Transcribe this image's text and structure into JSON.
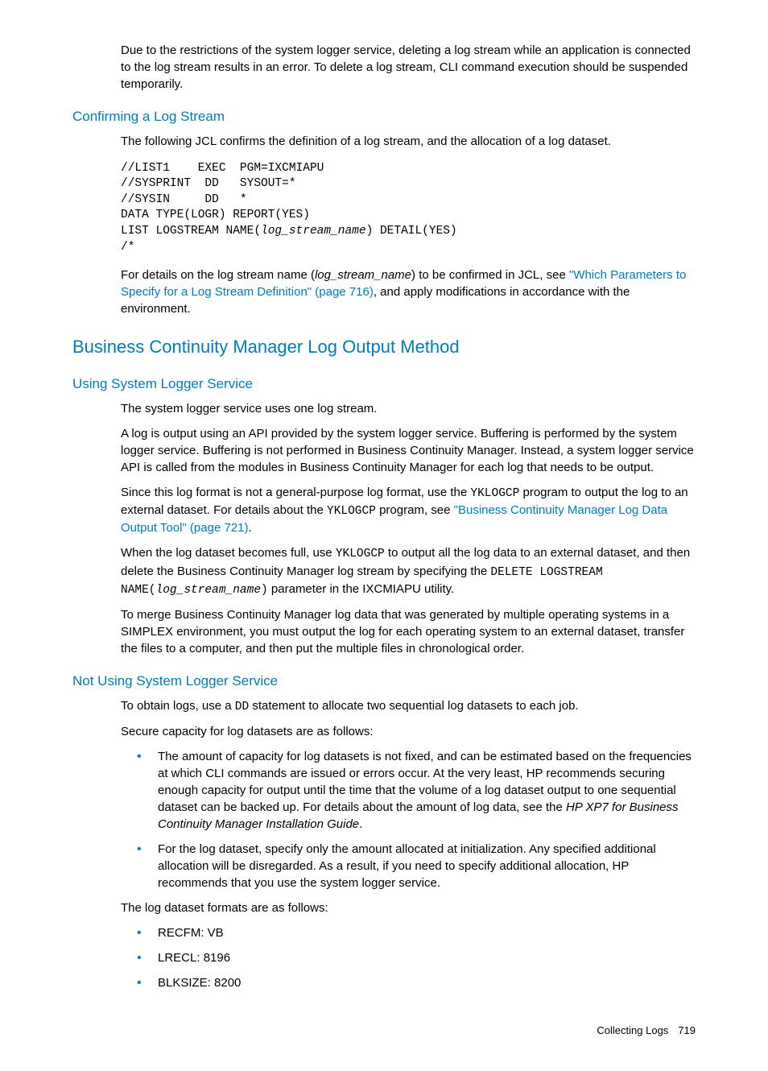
{
  "intro": {
    "p1": "Due to the restrictions of the system logger service, deleting a log stream while an application is connected to the log stream results in an error. To delete a log stream, CLI command execution should be suspended temporarily."
  },
  "confirming": {
    "heading": "Confirming a Log Stream",
    "p1": "The following JCL confirms the definition of a log stream, and the allocation of a log dataset.",
    "code_l1": "//LIST1    EXEC  PGM=IXCMIAPU",
    "code_l2": "//SYSPRINT  DD   SYSOUT=*",
    "code_l3": "//SYSIN     DD   *",
    "code_l4": "DATA TYPE(LOGR) REPORT(YES)",
    "code_l5a": "LIST LOGSTREAM NAME(",
    "code_l5b": "log_stream_name",
    "code_l5c": ") DETAIL(YES)",
    "code_l6": "/*",
    "p2a": "For details on the log stream name (",
    "p2b": "log_stream_name",
    "p2c": ") to be confirmed in JCL, see ",
    "p2link": "\"Which Parameters to Specify for a Log Stream Definition\" (page 716)",
    "p2d": ", and apply modifications in accordance with the environment."
  },
  "bcm": {
    "heading": "Business Continuity Manager Log Output Method"
  },
  "using": {
    "heading": "Using System Logger Service",
    "p1": "The system logger service uses one log stream.",
    "p2": "A log is output using an API provided by the system logger service. Buffering is performed by the system logger service. Buffering is not performed in Business Continuity Manager. Instead, a system logger service API is called from the modules in Business Continuity Manager for each log that needs to be output.",
    "p3a": "Since this log format is not a general-purpose log format, use the ",
    "p3m1": "YKLOGCP",
    "p3b": " program to output the log to an external dataset. For details about the ",
    "p3m2": "YKLOGCP",
    "p3c": " program, see ",
    "p3link": "\"Business Continuity Manager Log Data Output Tool\" (page 721)",
    "p3d": ".",
    "p4a": "When the log dataset becomes full, use ",
    "p4m1": "YKLOGCP",
    "p4b": " to output all the log data to an external dataset, and then delete the Business Continuity Manager log stream by specifying the ",
    "p4m2": "DELETE LOGSTREAM NAME(",
    "p4m3": "log_stream_name",
    "p4m4": ")",
    "p4c": " parameter in the IXCMIAPU utility.",
    "p5": "To merge Business Continuity Manager log data that was generated by multiple operating systems in a SIMPLEX environment, you must output the log for each operating system to an external dataset, transfer the files to a computer, and then put the multiple files in chronological order."
  },
  "notusing": {
    "heading": "Not Using System Logger Service",
    "p1a": "To obtain logs, use a ",
    "p1m": "DD",
    "p1b": " statement to allocate two sequential log datasets to each job.",
    "p2": "Secure capacity for log datasets are as follows:",
    "b1a": "The amount of capacity for log datasets is not fixed, and can be estimated based on the frequencies at which CLI commands are issued or errors occur. At the very least, HP recommends securing enough capacity for output until the time that the volume of a log dataset output to one sequential dataset can be backed up. For details about the amount of log data, see the ",
    "b1i": "HP XP7 for Business Continuity Manager Installation Guide",
    "b1b": ".",
    "b2": "For the log dataset, specify only the amount allocated at initialization. Any specified additional allocation will be disregarded. As a result, if you need to specify additional allocation, HP recommends that you use the system logger service.",
    "p3": "The log dataset formats are as follows:",
    "f1": "RECFM: VB",
    "f2": "LRECL: 8196",
    "f3": "BLKSIZE: 8200"
  },
  "footer": {
    "section": "Collecting Logs",
    "page": "719"
  }
}
